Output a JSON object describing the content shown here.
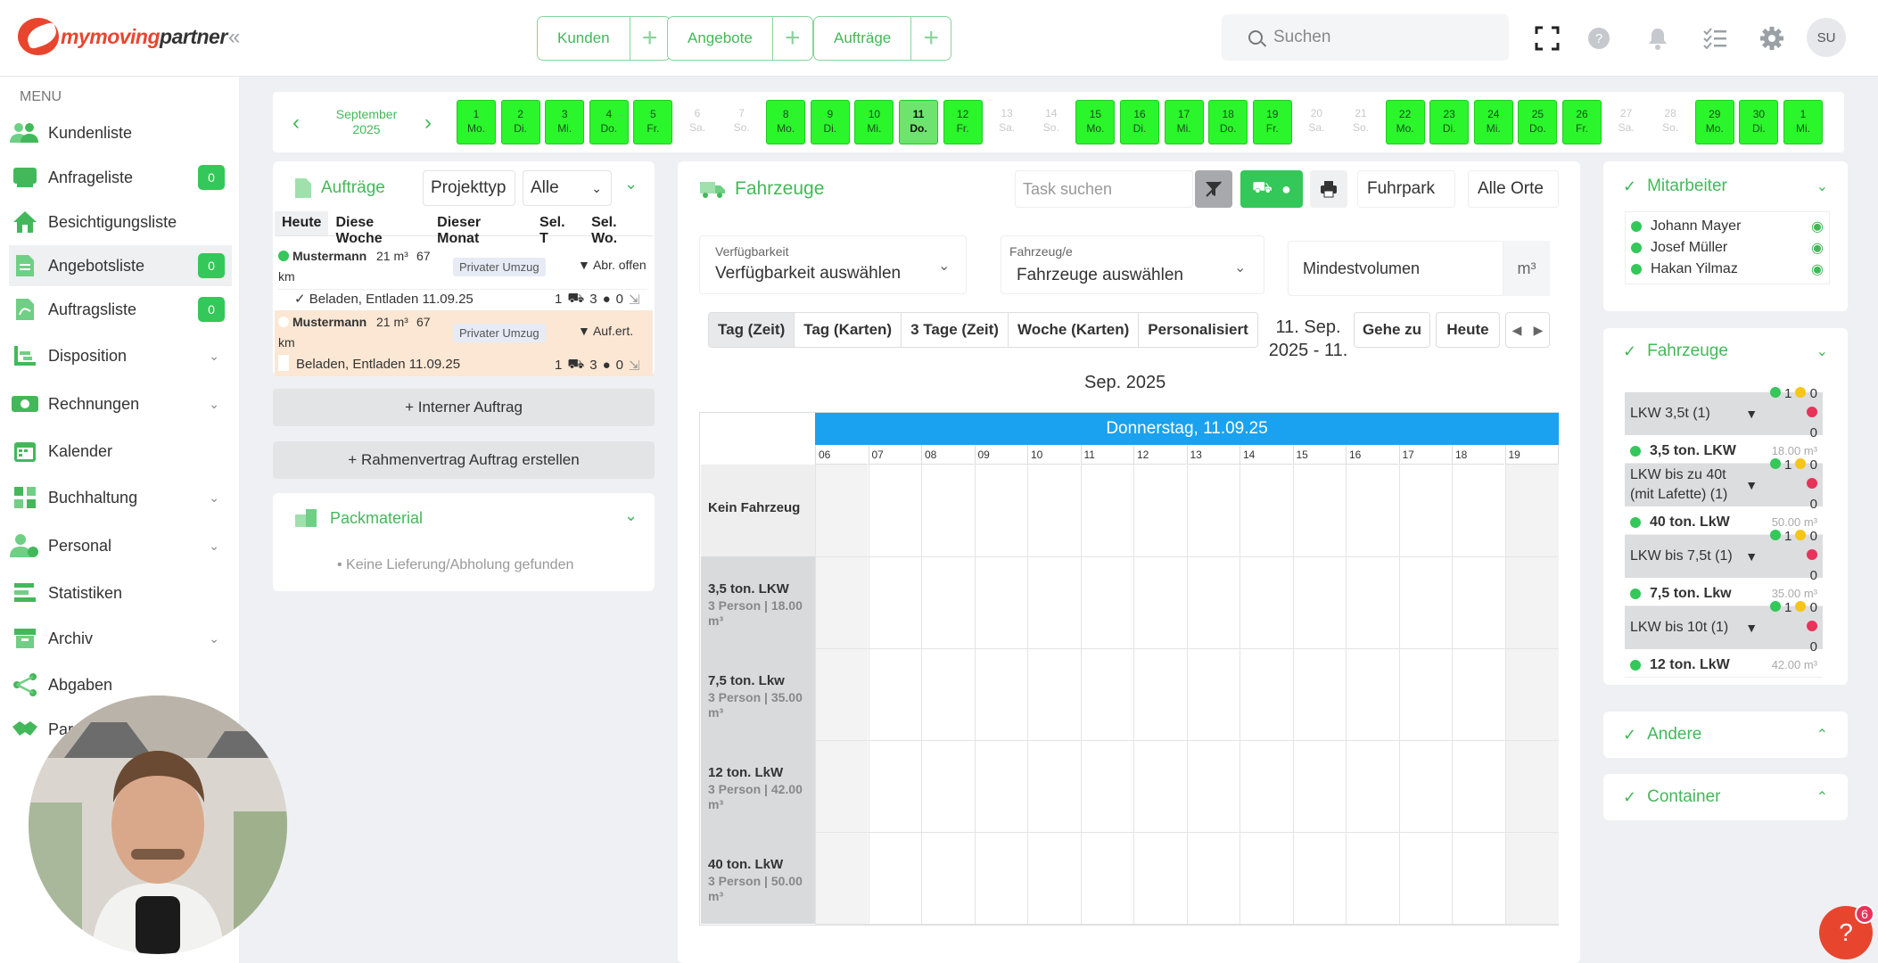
{
  "brand": {
    "name_a": "my",
    "name_b": "moving",
    "name_c": "partner"
  },
  "top": {
    "groups": [
      {
        "label": "Kunden"
      },
      {
        "label": "Angebote"
      },
      {
        "label": "Aufträge"
      }
    ],
    "search_placeholder": "Suchen",
    "avatar": "SU"
  },
  "sidebar": {
    "menu_title": "MENU",
    "items": [
      {
        "label": "Kundenliste",
        "icon": "users-icon"
      },
      {
        "label": "Anfrageliste",
        "badge": "0",
        "icon": "inbox-icon"
      },
      {
        "label": "Besichtigungsliste",
        "icon": "house-icon"
      },
      {
        "label": "Angebotsliste",
        "badge": "0",
        "icon": "document-icon"
      },
      {
        "label": "Auftragsliste",
        "badge": "0",
        "icon": "pdf-icon"
      },
      {
        "label": "Disposition",
        "icon": "flow-icon"
      },
      {
        "label": "Rechnungen",
        "icon": "money-icon"
      },
      {
        "label": "Kalender",
        "icon": "calendar-icon"
      },
      {
        "label": "Buchhaltung",
        "icon": "grid-icon"
      },
      {
        "label": "Personal",
        "icon": "person-clock-icon"
      },
      {
        "label": "Statistiken",
        "icon": "bars-icon"
      },
      {
        "label": "Archiv",
        "icon": "archive-icon"
      },
      {
        "label": "Abgaben",
        "icon": "share-icon"
      },
      {
        "label": "Par",
        "icon": "handshake-icon"
      }
    ]
  },
  "datebar": {
    "month": "September",
    "year": "2025",
    "days": [
      {
        "d": "1",
        "w": "Mo."
      },
      {
        "d": "2",
        "w": "Di."
      },
      {
        "d": "3",
        "w": "Mi."
      },
      {
        "d": "4",
        "w": "Do."
      },
      {
        "d": "5",
        "w": "Fr."
      },
      {
        "d": "6",
        "w": "Sa."
      },
      {
        "d": "7",
        "w": "So."
      },
      {
        "d": "8",
        "w": "Mo."
      },
      {
        "d": "9",
        "w": "Di."
      },
      {
        "d": "10",
        "w": "Mi."
      },
      {
        "d": "11",
        "w": "Do."
      },
      {
        "d": "12",
        "w": "Fr."
      },
      {
        "d": "13",
        "w": "Sa."
      },
      {
        "d": "14",
        "w": "So."
      },
      {
        "d": "15",
        "w": "Mo."
      },
      {
        "d": "16",
        "w": "Di."
      },
      {
        "d": "17",
        "w": "Mi."
      },
      {
        "d": "18",
        "w": "Do."
      },
      {
        "d": "19",
        "w": "Fr."
      },
      {
        "d": "20",
        "w": "Sa."
      },
      {
        "d": "21",
        "w": "So."
      },
      {
        "d": "22",
        "w": "Mo."
      },
      {
        "d": "23",
        "w": "Di."
      },
      {
        "d": "24",
        "w": "Mi."
      },
      {
        "d": "25",
        "w": "Do."
      },
      {
        "d": "26",
        "w": "Fr."
      },
      {
        "d": "27",
        "w": "Sa."
      },
      {
        "d": "28",
        "w": "So."
      },
      {
        "d": "29",
        "w": "Mo."
      },
      {
        "d": "30",
        "w": "Di."
      },
      {
        "d": "1",
        "w": "Mi."
      }
    ]
  },
  "auftraege": {
    "title": "Aufträge",
    "projekttyp": "Projekttyp",
    "filter": "Alle",
    "tabs": [
      "Heute",
      "Diese Woche",
      "Dieser Monat",
      "Sel. T",
      "Sel. Wo."
    ],
    "rows": [
      {
        "name": "Mustermann",
        "vol": "21 m³",
        "km": "67",
        "km_unit": "km",
        "tag": "Privater Umzug",
        "status": "▼ Abr. offen",
        "task": "✓ Beladen, Entladen 11.09.25",
        "n1": "1",
        "n2": "3",
        "n3": "0"
      },
      {
        "name": "Mustermann",
        "vol": "21 m³",
        "km": "67",
        "km_unit": "km",
        "tag": "Privater Umzug",
        "status": "▼ Auf.ert.",
        "task": "Beladen, Entladen 11.09.25",
        "n1": "1",
        "n2": "3",
        "n3": "0"
      }
    ],
    "btn_intern": "+ Interner Auftrag",
    "btn_rahmen": "+ Rahmenvertrag Auftrag erstellen"
  },
  "packmaterial": {
    "title": "Packmaterial",
    "empty": "• Keine Lieferung/Abholung gefunden"
  },
  "fahrzeuge": {
    "title": "Fahrzeuge",
    "task_placeholder": "Task suchen",
    "fuhrpark": "Fuhrpark",
    "alle_orte": "Alle Orte",
    "verf_label": "Verfügbarkeit",
    "verf_value": "Verfügbarkeit auswählen",
    "fz_label": "Fahrzeug/e",
    "fz_value": "Fahrzeuge auswählen",
    "mindest": "Mindestvolumen",
    "unit": "m³",
    "tabs": [
      "Tag (Zeit)",
      "Tag (Karten)",
      "3 Tage (Zeit)",
      "Woche (Karten)",
      "Personalisiert"
    ],
    "range_a": "11. Sep.",
    "range_b": "2025 - 11.",
    "range_c": "Sep. 2025",
    "gehe": "Gehe zu",
    "heute": "Heute",
    "day_header": "Donnerstag, 11.09.25",
    "hours": [
      "06",
      "07",
      "08",
      "09",
      "10",
      "11",
      "12",
      "13",
      "14",
      "15",
      "16",
      "17",
      "18",
      "19"
    ],
    "rows": [
      {
        "label": "Kein Fahrzeug",
        "sub": ""
      },
      {
        "label": "3,5 ton. LKW",
        "sub": "3 Person | 18.00 m³"
      },
      {
        "label": "7,5 ton. Lkw",
        "sub": "3 Person | 35.00 m³"
      },
      {
        "label": "12 ton. LkW",
        "sub": "3 Person | 42.00 m³"
      },
      {
        "label": "40 ton. LkW",
        "sub": "3 Person | 50.00 m³"
      }
    ]
  },
  "right": {
    "mitarbeiter": {
      "title": "Mitarbeiter",
      "people": [
        "Johann Mayer",
        "Josef Müller",
        "Hakan Yilmaz"
      ]
    },
    "fahrzeuge": {
      "title": "Fahrzeuge",
      "groups": [
        {
          "group": "LKW 3,5t (1)",
          "g": "1",
          "y": "0",
          "r": "0",
          "item": "3,5 ton. LKW",
          "vol": "18.00 m³"
        },
        {
          "group": "LKW bis zu 40t (mit Lafette) (1)",
          "g": "1",
          "y": "0",
          "r": "0",
          "item": "40 ton. LkW",
          "vol": "50.00 m³"
        },
        {
          "group": "LKW bis 7,5t (1)",
          "g": "1",
          "y": "0",
          "r": "0",
          "item": "7,5 ton. Lkw",
          "vol": "35.00 m³"
        },
        {
          "group": "LKW bis 10t (1)",
          "g": "1",
          "y": "0",
          "r": "0",
          "item": "12 ton. LkW",
          "vol": "42.00 m³"
        }
      ]
    },
    "andere": "Andere",
    "container": "Container"
  },
  "help": {
    "label": "?",
    "count": "6"
  }
}
